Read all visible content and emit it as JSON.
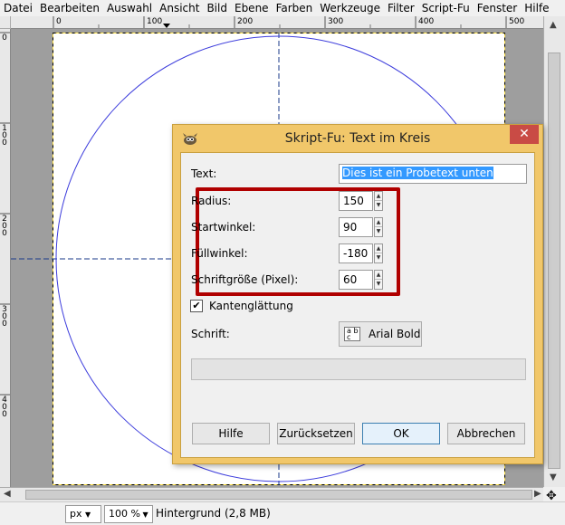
{
  "menubar": {
    "items": [
      "Datei",
      "Bearbeiten",
      "Auswahl",
      "Ansicht",
      "Bild",
      "Ebene",
      "Farben",
      "Werkzeuge",
      "Filter",
      "Script-Fu",
      "Fenster",
      "Hilfe"
    ]
  },
  "ruler_top": {
    "labels": [
      "0",
      "100",
      "200",
      "300",
      "400",
      "500"
    ]
  },
  "ruler_left": {
    "labels": [
      "0",
      "100",
      "200",
      "300",
      "400"
    ]
  },
  "statusbar": {
    "unit": "px",
    "zoom": "100 %",
    "layer_info": "Hintergrund (2,8 MB)"
  },
  "dialog": {
    "title": "Skript-Fu: Text im Kreis",
    "close_glyph": "✕",
    "text_label": "Text:",
    "text_value": "Dies ist ein Probetext unten",
    "radius_label": "Radius:",
    "radius_value": "150",
    "start_angle_label": "Startwinkel:",
    "start_angle_value": "90",
    "fill_angle_label": "Füllwinkel:",
    "fill_angle_value": "-180",
    "font_size_label": "Schriftgröße (Pixel):",
    "font_size_value": "60",
    "antialias_label": "Kantenglättung",
    "antialias_checked": true,
    "font_label": "Schrift:",
    "font_value": "Arial Bold",
    "font_icon_text": "a b c",
    "buttons": {
      "help": "Hilfe",
      "reset": "Zurücksetzen",
      "ok": "OK",
      "cancel": "Abbrechen"
    }
  },
  "colors": {
    "dialog_frame": "#f1c76a",
    "highlight": "#b00000",
    "circle": "#3c3cdc",
    "close_button": "#c94b45"
  }
}
